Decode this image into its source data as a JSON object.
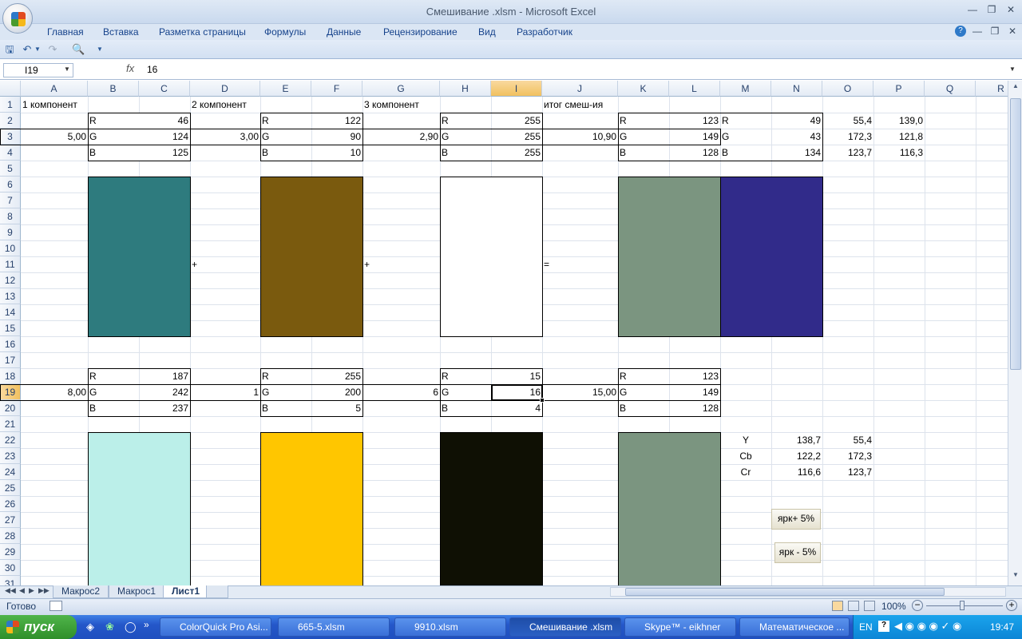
{
  "window": {
    "title": "Смешивание .xlsm - Microsoft Excel"
  },
  "ribbon_tabs": [
    "Главная",
    "Вставка",
    "Разметка страницы",
    "Формулы",
    "Данные",
    "Рецензирование",
    "Вид",
    "Разработчик"
  ],
  "formula_bar": {
    "name_box": "I19",
    "fx_label": "fx",
    "value": "16"
  },
  "columns": [
    "A",
    "B",
    "C",
    "D",
    "E",
    "F",
    "G",
    "H",
    "I",
    "J",
    "K",
    "L",
    "M",
    "N",
    "O",
    "P",
    "Q",
    "R"
  ],
  "rows": [
    "1",
    "2",
    "3",
    "4",
    "5",
    "6",
    "7",
    "8",
    "9",
    "10",
    "11",
    "12",
    "13",
    "14",
    "15",
    "16",
    "17",
    "18",
    "19",
    "20",
    "21",
    "22",
    "23",
    "24",
    "25",
    "26",
    "27",
    "28",
    "29",
    "30",
    "31"
  ],
  "cells": {
    "A1": "1 компонент",
    "D1": "2 компонент",
    "G1": "3 компонент",
    "J1": "итог смеш-ия",
    "B2": "R",
    "C2": "46",
    "E2": "R",
    "F2": "122",
    "H2": "R",
    "I2": "255",
    "K2": "R",
    "L2": "123",
    "M2": "R",
    "N2": "49",
    "O2": "55,4",
    "P2": "139,0",
    "A3": "5,00",
    "B3": "G",
    "C3": "124",
    "D3": "3,00",
    "E3": "G",
    "F3": "90",
    "G3": "2,90",
    "H3": "G",
    "I3": "255",
    "J3": "10,90",
    "K3": "G",
    "L3": "149",
    "M3": "G",
    "N3": "43",
    "O3": "172,3",
    "P3": "121,8",
    "B4": "B",
    "C4": "125",
    "E4": "B",
    "F4": "10",
    "H4": "B",
    "I4": "255",
    "K4": "B",
    "L4": "128",
    "M4": "B",
    "N4": "134",
    "O4": "123,7",
    "P4": "116,3",
    "D11": "+",
    "G11": "+",
    "J11": "=",
    "B18": "R",
    "C18": "187",
    "E18": "R",
    "F18": "255",
    "H18": "R",
    "I18": "15",
    "K18": "R",
    "L18": "123",
    "A19": "8,00",
    "B19": "G",
    "C19": "242",
    "D19": "1",
    "E19": "G",
    "F19": "200",
    "G19": "6",
    "H19": "G",
    "I19": "16",
    "J19": "15,00",
    "K19": "G",
    "L19": "149",
    "B20": "B",
    "C20": "237",
    "E20": "B",
    "F20": "5",
    "H20": "B",
    "I20": "4",
    "K20": "B",
    "L20": "128",
    "M22": "Y",
    "N22": "138,7",
    "O22": "55,4",
    "M23": "Cb",
    "N23": "122,2",
    "O23": "172,3",
    "M24": "Cr",
    "N24": "116,6",
    "O24": "123,7"
  },
  "swatch_colors": {
    "s1": "#2e7b7e",
    "s2": "#7a5a0e",
    "s3": "#ffffff",
    "s4": "#7b9580",
    "s5": "#312b8a",
    "s6": "#bbefe9",
    "s7": "#ffc600",
    "s8": "#0f1004",
    "s9": "#7b9580"
  },
  "buttons": {
    "bright_up": "ярк+ 5%",
    "bright_down": "ярк - 5%"
  },
  "sheets": [
    "Макрос2",
    "Макрос1",
    "Лист1"
  ],
  "active_sheet": "Лист1",
  "status": {
    "ready": "Готово",
    "zoom": "100%"
  },
  "taskbar": {
    "start": "пуск",
    "items": [
      "ColorQuick Pro Asi...",
      "665-5.xlsm",
      "9910.xlsm",
      "Смешивание .xlsm",
      "Skype™ - eikhner",
      "Математическое ..."
    ],
    "lang": "EN",
    "clock": "19:47"
  }
}
